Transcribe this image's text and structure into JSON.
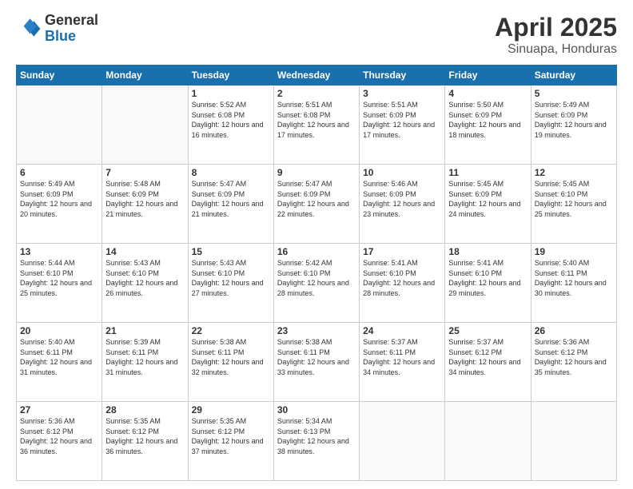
{
  "logo": {
    "general": "General",
    "blue": "Blue"
  },
  "title": {
    "month": "April 2025",
    "location": "Sinuapa, Honduras"
  },
  "weekdays": [
    "Sunday",
    "Monday",
    "Tuesday",
    "Wednesday",
    "Thursday",
    "Friday",
    "Saturday"
  ],
  "weeks": [
    [
      {
        "day": "",
        "empty": true
      },
      {
        "day": "",
        "empty": true
      },
      {
        "day": "1",
        "sunrise": "Sunrise: 5:52 AM",
        "sunset": "Sunset: 6:08 PM",
        "daylight": "Daylight: 12 hours and 16 minutes."
      },
      {
        "day": "2",
        "sunrise": "Sunrise: 5:51 AM",
        "sunset": "Sunset: 6:08 PM",
        "daylight": "Daylight: 12 hours and 17 minutes."
      },
      {
        "day": "3",
        "sunrise": "Sunrise: 5:51 AM",
        "sunset": "Sunset: 6:09 PM",
        "daylight": "Daylight: 12 hours and 17 minutes."
      },
      {
        "day": "4",
        "sunrise": "Sunrise: 5:50 AM",
        "sunset": "Sunset: 6:09 PM",
        "daylight": "Daylight: 12 hours and 18 minutes."
      },
      {
        "day": "5",
        "sunrise": "Sunrise: 5:49 AM",
        "sunset": "Sunset: 6:09 PM",
        "daylight": "Daylight: 12 hours and 19 minutes."
      }
    ],
    [
      {
        "day": "6",
        "sunrise": "Sunrise: 5:49 AM",
        "sunset": "Sunset: 6:09 PM",
        "daylight": "Daylight: 12 hours and 20 minutes."
      },
      {
        "day": "7",
        "sunrise": "Sunrise: 5:48 AM",
        "sunset": "Sunset: 6:09 PM",
        "daylight": "Daylight: 12 hours and 21 minutes."
      },
      {
        "day": "8",
        "sunrise": "Sunrise: 5:47 AM",
        "sunset": "Sunset: 6:09 PM",
        "daylight": "Daylight: 12 hours and 21 minutes."
      },
      {
        "day": "9",
        "sunrise": "Sunrise: 5:47 AM",
        "sunset": "Sunset: 6:09 PM",
        "daylight": "Daylight: 12 hours and 22 minutes."
      },
      {
        "day": "10",
        "sunrise": "Sunrise: 5:46 AM",
        "sunset": "Sunset: 6:09 PM",
        "daylight": "Daylight: 12 hours and 23 minutes."
      },
      {
        "day": "11",
        "sunrise": "Sunrise: 5:45 AM",
        "sunset": "Sunset: 6:09 PM",
        "daylight": "Daylight: 12 hours and 24 minutes."
      },
      {
        "day": "12",
        "sunrise": "Sunrise: 5:45 AM",
        "sunset": "Sunset: 6:10 PM",
        "daylight": "Daylight: 12 hours and 25 minutes."
      }
    ],
    [
      {
        "day": "13",
        "sunrise": "Sunrise: 5:44 AM",
        "sunset": "Sunset: 6:10 PM",
        "daylight": "Daylight: 12 hours and 25 minutes."
      },
      {
        "day": "14",
        "sunrise": "Sunrise: 5:43 AM",
        "sunset": "Sunset: 6:10 PM",
        "daylight": "Daylight: 12 hours and 26 minutes."
      },
      {
        "day": "15",
        "sunrise": "Sunrise: 5:43 AM",
        "sunset": "Sunset: 6:10 PM",
        "daylight": "Daylight: 12 hours and 27 minutes."
      },
      {
        "day": "16",
        "sunrise": "Sunrise: 5:42 AM",
        "sunset": "Sunset: 6:10 PM",
        "daylight": "Daylight: 12 hours and 28 minutes."
      },
      {
        "day": "17",
        "sunrise": "Sunrise: 5:41 AM",
        "sunset": "Sunset: 6:10 PM",
        "daylight": "Daylight: 12 hours and 28 minutes."
      },
      {
        "day": "18",
        "sunrise": "Sunrise: 5:41 AM",
        "sunset": "Sunset: 6:10 PM",
        "daylight": "Daylight: 12 hours and 29 minutes."
      },
      {
        "day": "19",
        "sunrise": "Sunrise: 5:40 AM",
        "sunset": "Sunset: 6:11 PM",
        "daylight": "Daylight: 12 hours and 30 minutes."
      }
    ],
    [
      {
        "day": "20",
        "sunrise": "Sunrise: 5:40 AM",
        "sunset": "Sunset: 6:11 PM",
        "daylight": "Daylight: 12 hours and 31 minutes."
      },
      {
        "day": "21",
        "sunrise": "Sunrise: 5:39 AM",
        "sunset": "Sunset: 6:11 PM",
        "daylight": "Daylight: 12 hours and 31 minutes."
      },
      {
        "day": "22",
        "sunrise": "Sunrise: 5:38 AM",
        "sunset": "Sunset: 6:11 PM",
        "daylight": "Daylight: 12 hours and 32 minutes."
      },
      {
        "day": "23",
        "sunrise": "Sunrise: 5:38 AM",
        "sunset": "Sunset: 6:11 PM",
        "daylight": "Daylight: 12 hours and 33 minutes."
      },
      {
        "day": "24",
        "sunrise": "Sunrise: 5:37 AM",
        "sunset": "Sunset: 6:11 PM",
        "daylight": "Daylight: 12 hours and 34 minutes."
      },
      {
        "day": "25",
        "sunrise": "Sunrise: 5:37 AM",
        "sunset": "Sunset: 6:12 PM",
        "daylight": "Daylight: 12 hours and 34 minutes."
      },
      {
        "day": "26",
        "sunrise": "Sunrise: 5:36 AM",
        "sunset": "Sunset: 6:12 PM",
        "daylight": "Daylight: 12 hours and 35 minutes."
      }
    ],
    [
      {
        "day": "27",
        "sunrise": "Sunrise: 5:36 AM",
        "sunset": "Sunset: 6:12 PM",
        "daylight": "Daylight: 12 hours and 36 minutes."
      },
      {
        "day": "28",
        "sunrise": "Sunrise: 5:35 AM",
        "sunset": "Sunset: 6:12 PM",
        "daylight": "Daylight: 12 hours and 36 minutes."
      },
      {
        "day": "29",
        "sunrise": "Sunrise: 5:35 AM",
        "sunset": "Sunset: 6:12 PM",
        "daylight": "Daylight: 12 hours and 37 minutes."
      },
      {
        "day": "30",
        "sunrise": "Sunrise: 5:34 AM",
        "sunset": "Sunset: 6:13 PM",
        "daylight": "Daylight: 12 hours and 38 minutes."
      },
      {
        "day": "",
        "empty": true
      },
      {
        "day": "",
        "empty": true
      },
      {
        "day": "",
        "empty": true
      }
    ]
  ]
}
